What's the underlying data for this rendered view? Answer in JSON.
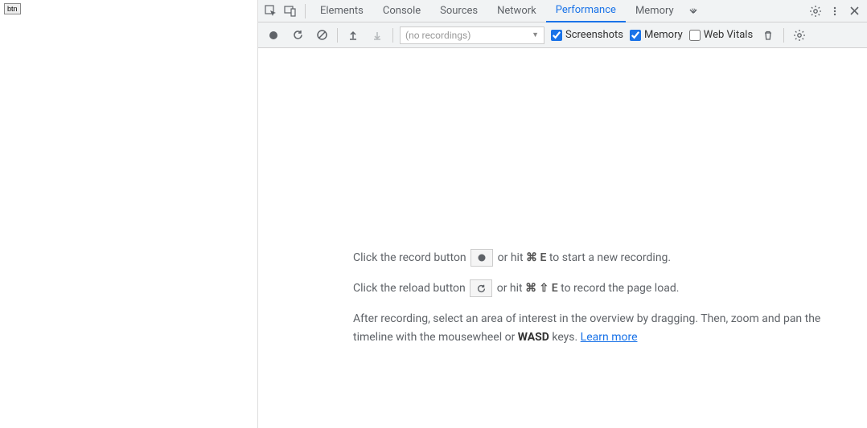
{
  "page": {
    "btn_label": "btn"
  },
  "tabs": {
    "elements": "Elements",
    "console": "Console",
    "sources": "Sources",
    "network": "Network",
    "performance": "Performance",
    "memory": "Memory"
  },
  "controls": {
    "recording_select_placeholder": "(no recordings)",
    "screenshots_label": "Screenshots",
    "memory_label": "Memory",
    "webvitals_label": "Web Vitals",
    "screenshots_checked": true,
    "memory_checked": true,
    "webvitals_checked": false
  },
  "empty": {
    "line1_a": "Click the record button ",
    "line1_b": " or hit ",
    "line1_key": "⌘ E",
    "line1_c": " to start a new recording.",
    "line2_a": "Click the reload button ",
    "line2_b": " or hit ",
    "line2_key": "⌘ ⇧ E",
    "line2_c": " to record the page load.",
    "line3_a": "After recording, select an area of interest in the overview by dragging. Then, zoom and pan the timeline with the mousewheel or ",
    "line3_wasd": "WASD",
    "line3_b": " keys. ",
    "learn_more": "Learn more"
  }
}
